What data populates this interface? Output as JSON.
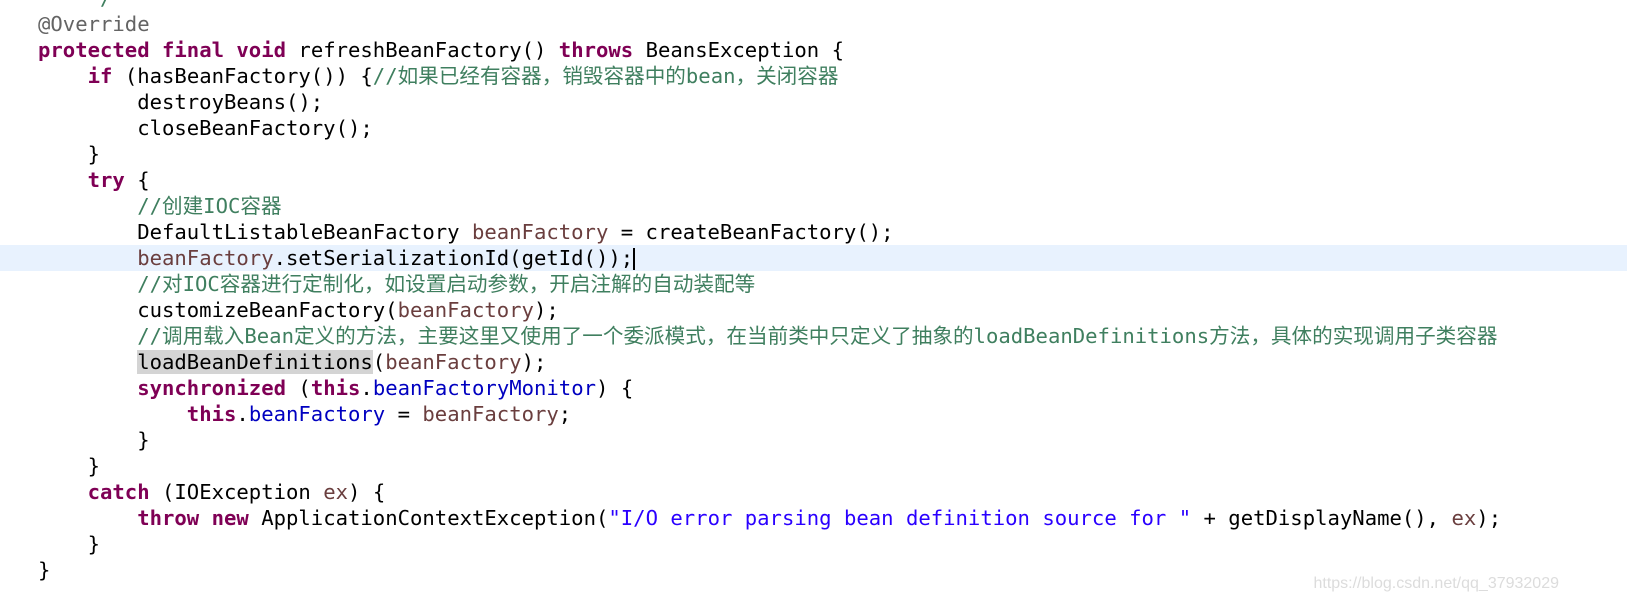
{
  "editor": {
    "current_line": 10,
    "colors": {
      "keyword": "#7F0055",
      "comment": "#3F7F5F",
      "field": "#0000C0",
      "local": "#6A3E3E",
      "string": "#2A00FF",
      "annotation": "#646464",
      "current_line_bg": "#E8F2FE",
      "occurrence_bg": "#D4D4D4"
    },
    "lines": [
      [
        [
          "    ",
          "p"
        ],
        [
          "*/",
          "cm"
        ]
      ],
      [
        [
          "@Override",
          "an"
        ]
      ],
      [
        [
          "protected",
          "kw"
        ],
        [
          " ",
          "p"
        ],
        [
          "final",
          "kw"
        ],
        [
          " ",
          "p"
        ],
        [
          "void",
          "kw"
        ],
        [
          " refreshBeanFactory() ",
          "p"
        ],
        [
          "throws",
          "kw"
        ],
        [
          " BeansException {",
          "p"
        ]
      ],
      [
        [
          "    ",
          "p"
        ],
        [
          "if",
          "kw"
        ],
        [
          " (hasBeanFactory()) {",
          "p"
        ],
        [
          "//如果已经有容器，销毁容器中的bean，关闭容器",
          "cm"
        ]
      ],
      [
        [
          "        destroyBeans();",
          "p"
        ]
      ],
      [
        [
          "        closeBeanFactory();",
          "p"
        ]
      ],
      [
        [
          "    }",
          "p"
        ]
      ],
      [
        [
          "    ",
          "p"
        ],
        [
          "try",
          "kw"
        ],
        [
          " {",
          "p"
        ]
      ],
      [
        [
          "        ",
          "p"
        ],
        [
          "//创建IOC容器",
          "cm"
        ]
      ],
      [
        [
          "        DefaultListableBeanFactory ",
          "p"
        ],
        [
          "beanFactory",
          "lv"
        ],
        [
          " = createBeanFactory();",
          "p"
        ]
      ],
      [
        [
          "        ",
          "p"
        ],
        [
          "beanFactory",
          "lv"
        ],
        [
          ".setSerializationId(getId());",
          "p"
        ],
        [
          "",
          "caret"
        ]
      ],
      [
        [
          "        ",
          "p"
        ],
        [
          "//对IOC容器进行定制化，如设置启动参数，开启注解的自动装配等",
          "cm"
        ]
      ],
      [
        [
          "        customizeBeanFactory(",
          "p"
        ],
        [
          "beanFactory",
          "lv"
        ],
        [
          ");",
          "p"
        ]
      ],
      [
        [
          "        ",
          "p"
        ],
        [
          "//调用载入Bean定义的方法，主要这里又使用了一个委派模式，在当前类中只定义了抽象的loadBeanDefinitions方法，具体的实现调用子类容器",
          "cm"
        ]
      ],
      [
        [
          "        ",
          "p"
        ],
        [
          "loadBeanDefinitions",
          "occ"
        ],
        [
          "(",
          "p"
        ],
        [
          "beanFactory",
          "lv"
        ],
        [
          ");",
          "p"
        ]
      ],
      [
        [
          "        ",
          "p"
        ],
        [
          "synchronized",
          "kw"
        ],
        [
          " (",
          "p"
        ],
        [
          "this",
          "kw"
        ],
        [
          ".",
          "p"
        ],
        [
          "beanFactoryMonitor",
          "fd"
        ],
        [
          ") {",
          "p"
        ]
      ],
      [
        [
          "            ",
          "p"
        ],
        [
          "this",
          "kw"
        ],
        [
          ".",
          "p"
        ],
        [
          "beanFactory",
          "fd"
        ],
        [
          " = ",
          "p"
        ],
        [
          "beanFactory",
          "lv"
        ],
        [
          ";",
          "p"
        ]
      ],
      [
        [
          "        }",
          "p"
        ]
      ],
      [
        [
          "    }",
          "p"
        ]
      ],
      [
        [
          "    ",
          "p"
        ],
        [
          "catch",
          "kw"
        ],
        [
          " (IOException ",
          "p"
        ],
        [
          "ex",
          "lv"
        ],
        [
          ") {",
          "p"
        ]
      ],
      [
        [
          "        ",
          "p"
        ],
        [
          "throw",
          "kw"
        ],
        [
          " ",
          "p"
        ],
        [
          "new",
          "kw"
        ],
        [
          " ApplicationContextException(",
          "p"
        ],
        [
          "\"I/O error parsing bean definition source for \"",
          "st"
        ],
        [
          " + getDisplayName(), ",
          "p"
        ],
        [
          "ex",
          "lv"
        ],
        [
          ");",
          "p"
        ]
      ],
      [
        [
          "    }",
          "p"
        ]
      ],
      [
        [
          "}",
          "p"
        ]
      ]
    ]
  },
  "watermark": "https://blog.csdn.net/qq_37932029"
}
